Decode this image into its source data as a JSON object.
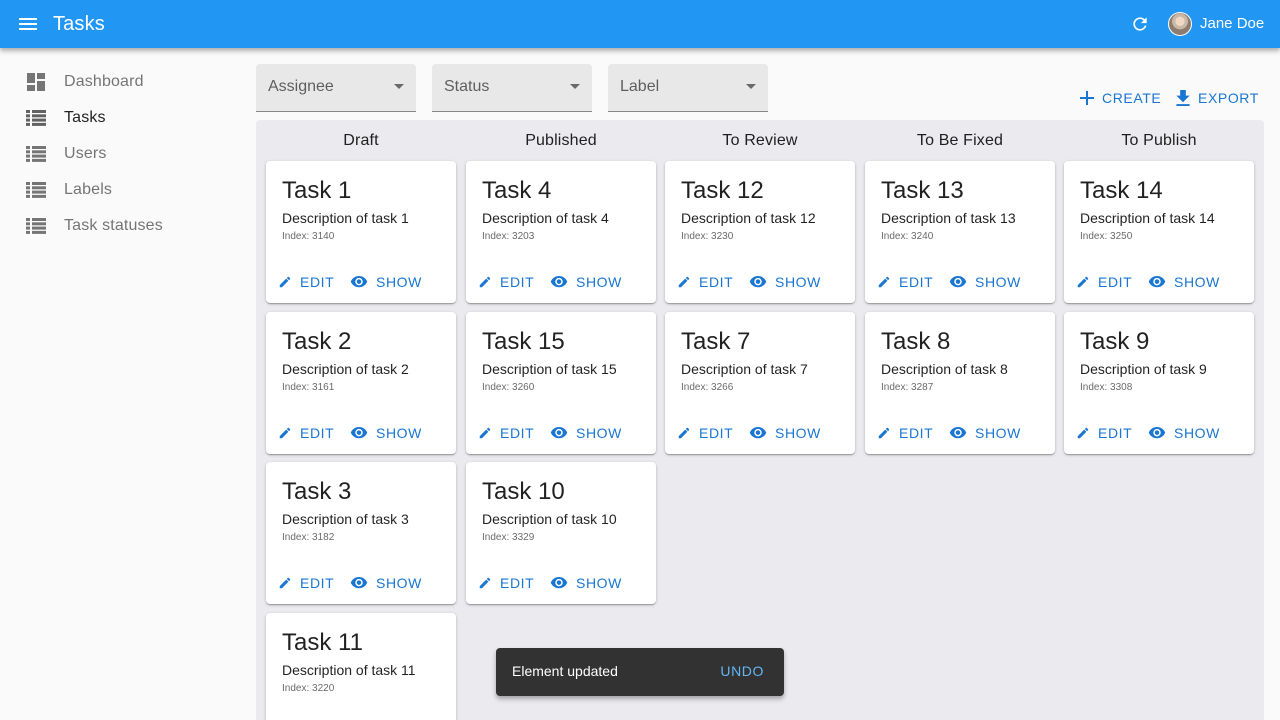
{
  "appbar": {
    "title": "Tasks",
    "user_name": "Jane Doe",
    "color": "#2196f3"
  },
  "sidebar": {
    "items": [
      {
        "label": "Dashboard",
        "icon": "dashboard-icon"
      },
      {
        "label": "Tasks",
        "icon": "list-icon",
        "active": true
      },
      {
        "label": "Users",
        "icon": "list-icon"
      },
      {
        "label": "Labels",
        "icon": "list-icon"
      },
      {
        "label": "Task statuses",
        "icon": "list-icon"
      }
    ]
  },
  "filters": {
    "assignee": "Assignee",
    "status": "Status",
    "label": "Label"
  },
  "actions": {
    "create": "CREATE",
    "export": "EXPORT"
  },
  "board": {
    "columns": [
      {
        "title": "Draft",
        "cards": [
          {
            "title": "Task 1",
            "description": "Description of task 1",
            "index": "Index: 3140"
          },
          {
            "title": "Task 2",
            "description": "Description of task 2",
            "index": "Index: 3161"
          },
          {
            "title": "Task 3",
            "description": "Description of task 3",
            "index": "Index: 3182"
          },
          {
            "title": "Task 11",
            "description": "Description of task 11",
            "index": "Index: 3220"
          }
        ]
      },
      {
        "title": "Published",
        "cards": [
          {
            "title": "Task 4",
            "description": "Description of task 4",
            "index": "Index: 3203"
          },
          {
            "title": "Task 15",
            "description": "Description of task 15",
            "index": "Index: 3260"
          },
          {
            "title": "Task 10",
            "description": "Description of task 10",
            "index": "Index: 3329"
          }
        ]
      },
      {
        "title": "To Review",
        "cards": [
          {
            "title": "Task 12",
            "description": "Description of task 12",
            "index": "Index: 3230"
          },
          {
            "title": "Task 7",
            "description": "Description of task 7",
            "index": "Index: 3266"
          }
        ]
      },
      {
        "title": "To Be Fixed",
        "cards": [
          {
            "title": "Task 13",
            "description": "Description of task 13",
            "index": "Index: 3240"
          },
          {
            "title": "Task 8",
            "description": "Description of task 8",
            "index": "Index: 3287"
          }
        ]
      },
      {
        "title": "To Publish",
        "cards": [
          {
            "title": "Task 14",
            "description": "Description of task 14",
            "index": "Index: 3250"
          },
          {
            "title": "Task 9",
            "description": "Description of task 9",
            "index": "Index: 3308"
          }
        ]
      }
    ],
    "card_actions": {
      "edit": "EDIT",
      "show": "SHOW"
    }
  },
  "snackbar": {
    "message": "Element updated",
    "action": "UNDO"
  }
}
